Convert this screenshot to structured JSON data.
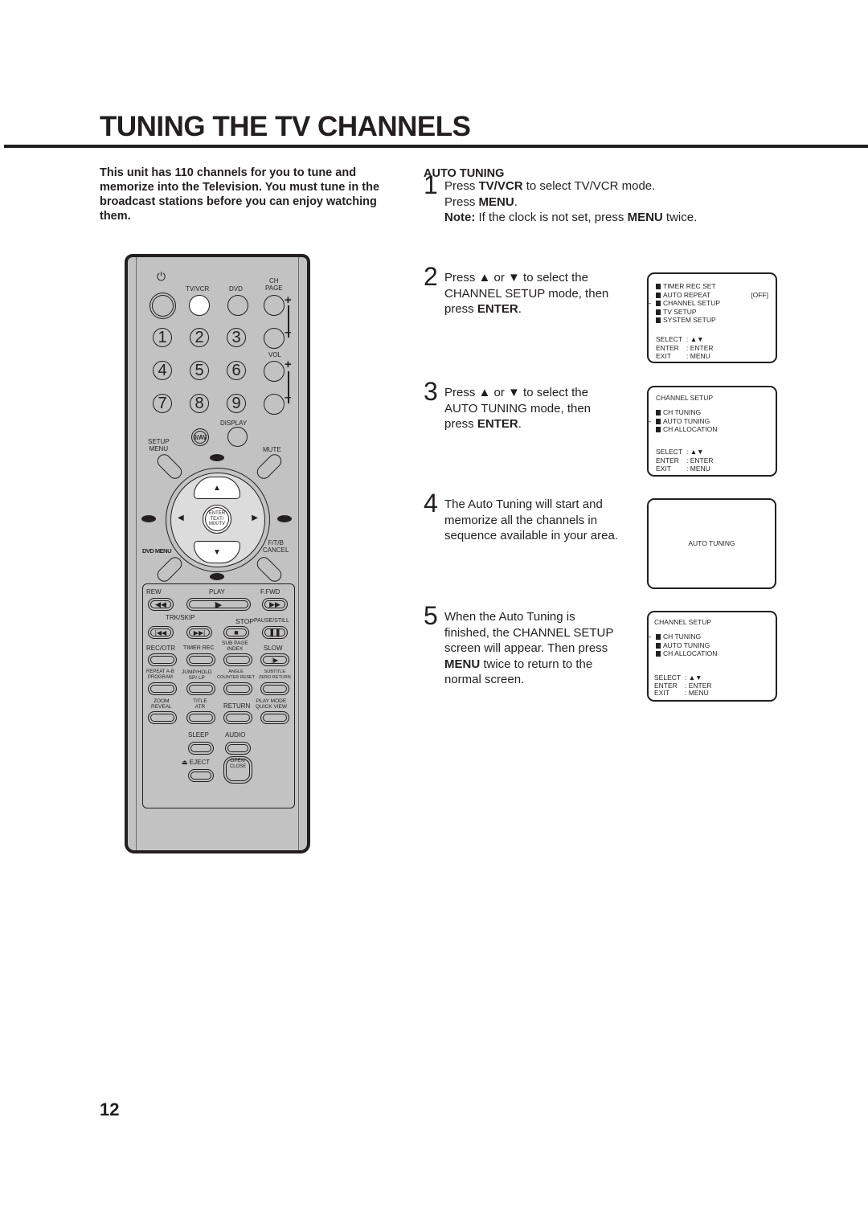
{
  "page": {
    "title": "TUNING THE TV CHANNELS",
    "intro": "This unit has 110 channels for you to tune and memorize into the Television. You must tune in the broadcast stations before you can enjoy watching them.",
    "section_heading": "AUTO TUNING",
    "page_number": "12"
  },
  "steps": [
    {
      "num": "1",
      "lines": [
        "Press <b>TV/VCR</b> to select TV/VCR mode.",
        "Press <b>MENU</b>.",
        "<b>Note:</b>  If the clock is not set, press <b>MENU</b> twice."
      ]
    },
    {
      "num": "2",
      "lines": [
        "Press ▲ or ▼ to select the",
        "CHANNEL SETUP mode, then",
        "press <b>ENTER</b>."
      ]
    },
    {
      "num": "3",
      "lines": [
        "Press ▲ or ▼ to select the",
        "AUTO TUNING mode, then",
        "press <b>ENTER</b>."
      ]
    },
    {
      "num": "4",
      "lines": [
        "The Auto Tuning will start and",
        "memorize all the channels in",
        "sequence available in your area."
      ]
    },
    {
      "num": "5",
      "lines": [
        "When the Auto Tuning is",
        "finished, the CHANNEL SETUP",
        "screen will appear. Then press",
        "<b>MENU</b> twice to return to the",
        "normal screen."
      ]
    }
  ],
  "osd": {
    "main_menu": {
      "items": [
        "TIMER  REC  SET",
        "AUTO REPEAT",
        "CHANNEL SETUP",
        "TV SETUP",
        "SYSTEM  SETUP"
      ],
      "auto_repeat_value": "[OFF]",
      "selected": "CHANNEL SETUP"
    },
    "channel_setup_1": {
      "title": "CHANNEL SETUP",
      "items": [
        "CH TUNING",
        "AUTO TUNING",
        "CH ALLOCATION"
      ],
      "selected": "AUTO TUNING"
    },
    "auto_tuning_screen": {
      "text": "AUTO TUNING"
    },
    "channel_setup_2": {
      "title": "CHANNEL SETUP",
      "items": [
        "CH TUNING",
        "AUTO TUNING",
        "CH ALLOCATION"
      ],
      "selected": "CH TUNING"
    },
    "keys": {
      "select_label": "SELECT",
      "select_value": "▲▼",
      "enter_label": "ENTER",
      "enter_value": "ENTER",
      "exit_label": "EXIT",
      "exit_value": "MENU"
    }
  },
  "remote": {
    "top_labels": {
      "power": "⏻",
      "tv_vcr": "TV/VCR",
      "dvd": "DVD",
      "ch_page": "CH\nPAGE",
      "vol": "VOL",
      "display": "DISPLAY",
      "setup_menu": "SETUP\nMENU",
      "mute": "MUTE",
      "dvd_menu": "DVD MENU",
      "ftb_cancel": "F/T/B\nCANCEL",
      "zero_av": "0/AV",
      "enter": "ENTER\nTEXT/\nMIX/TV",
      "plus": "+",
      "minus": "–"
    },
    "digits": [
      "1",
      "2",
      "3",
      "4",
      "5",
      "6",
      "7",
      "8",
      "9"
    ],
    "transport": {
      "rew": "REW",
      "play": "PLAY",
      "ffwd": "F.FWD",
      "trk_skip": "TRK/SKIP",
      "stop": "STOP",
      "pause_still": "PAUSE/STILL",
      "rec_otr": "REC/OTR",
      "timer_rec": "TIMER REC",
      "sub_page_index": "SUB PAGE\nINDEX",
      "slow": "SLOW"
    },
    "lower": {
      "repeat_program": "REPEAT A-B\nPROGRAM",
      "jump_sp_lp": "JUMP/HOLD\nSP/ LP",
      "angle_counter": "ANGLE\nCOUNTER RESET",
      "subtitle_zero": "SUBTITLE\nZERO RETURN",
      "zoom_reveal": "ZOOM\nREVEAL",
      "title_atr": "TITLE\nATR",
      "return": "RETURN",
      "playmode_quickview": "PLAY MODE\nQUICK VIEW",
      "sleep": "SLEEP",
      "audio": "AUDIO",
      "eject": "⏏ EJECT",
      "open_close": "OPEN/\nCLOSE"
    }
  }
}
